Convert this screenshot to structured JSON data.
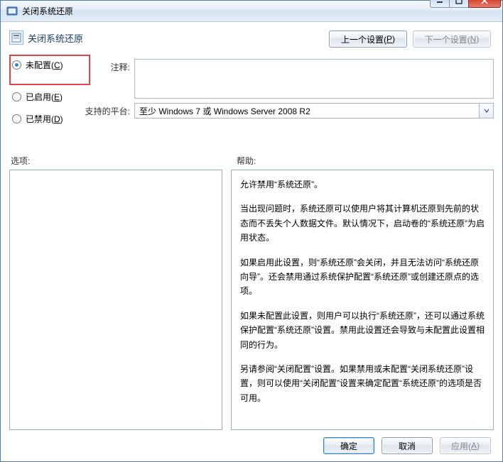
{
  "window": {
    "title": "关闭系统还原"
  },
  "header": {
    "title": "关闭系统还原",
    "prev_button": {
      "label": "上一个设置(",
      "key": "P",
      "suffix": ")"
    },
    "next_button": {
      "label": "下一个设置(",
      "key": "N",
      "suffix": ")"
    }
  },
  "radios": {
    "not_configured": {
      "label": "未配置(",
      "key": "C",
      "suffix": ")",
      "checked": true
    },
    "enabled": {
      "label": "已启用(",
      "key": "E",
      "suffix": ")",
      "checked": false
    },
    "disabled": {
      "label": "已禁用(",
      "key": "D",
      "suffix": ")",
      "checked": false
    }
  },
  "fields": {
    "comment": {
      "label": "注释:",
      "value": ""
    },
    "platform": {
      "label": "支持的平台:",
      "value": "至少 Windows 7 或 Windows Server 2008 R2"
    }
  },
  "sections": {
    "options_label": "选项:",
    "help_label": "帮助:"
  },
  "help": {
    "p1": "允许禁用“系统还原”。",
    "p2": "当出现问题时，系统还原可以使用户将其计算机还原到先前的状态而不丢失个人数据文件。默认情况下，启动卷的“系统还原”为启用状态。",
    "p3": "如果启用此设置，则“系统还原”会关闭，并且无法访问“系统还原向导”。还会禁用通过系统保护配置“系统还原”或创建还原点的选项。",
    "p4": "如果未配置此设置，则用户可以执行“系统还原”，还可以通过系统保护配置“系统还原”设置。禁用此设置还会导致与未配置此设置相同的行为。",
    "p5": "另请参阅“关闭配置”设置。如果禁用或未配置“关闭系统还原”设置，则可以使用“关闭配置”设置来确定配置“系统还原”的选项是否可用。"
  },
  "footer": {
    "ok": "确定",
    "cancel": "取消",
    "apply": {
      "label": "应用(",
      "key": "A",
      "suffix": ")"
    }
  }
}
